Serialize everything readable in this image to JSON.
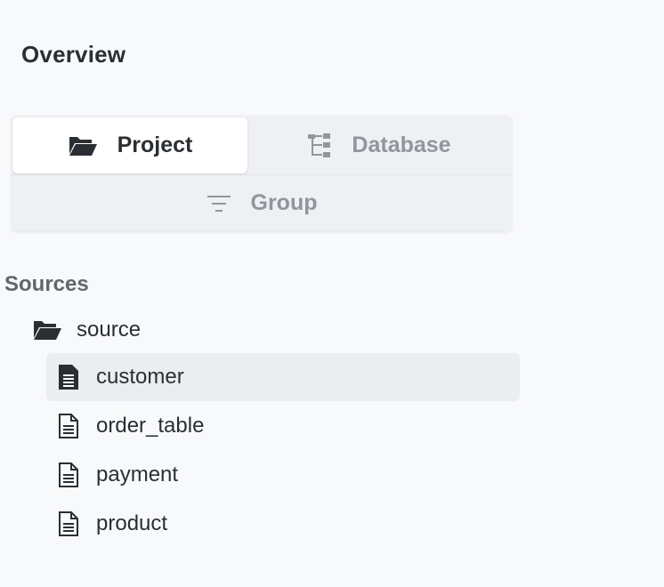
{
  "overview": {
    "title": "Overview"
  },
  "view_switcher": {
    "tabs": [
      {
        "label": "Project",
        "icon": "folder-open-icon",
        "active": true
      },
      {
        "label": "Database",
        "icon": "tree-structure-icon",
        "active": false
      },
      {
        "label": "Group",
        "icon": "filter-icon",
        "active": false
      }
    ]
  },
  "sources": {
    "heading": "Sources",
    "folder": {
      "label": "source",
      "icon": "folder-open-icon"
    },
    "items": [
      {
        "label": "customer",
        "icon": "file-text-icon",
        "selected": true
      },
      {
        "label": "order_table",
        "icon": "file-text-outline-icon",
        "selected": false
      },
      {
        "label": "payment",
        "icon": "file-text-outline-icon",
        "selected": false
      },
      {
        "label": "product",
        "icon": "file-text-outline-icon",
        "selected": false
      }
    ]
  },
  "colors": {
    "background": "#f8f9fb",
    "text_primary": "#2b2f33",
    "text_muted": "#8f969d",
    "selected_row": "#ebedf0"
  }
}
